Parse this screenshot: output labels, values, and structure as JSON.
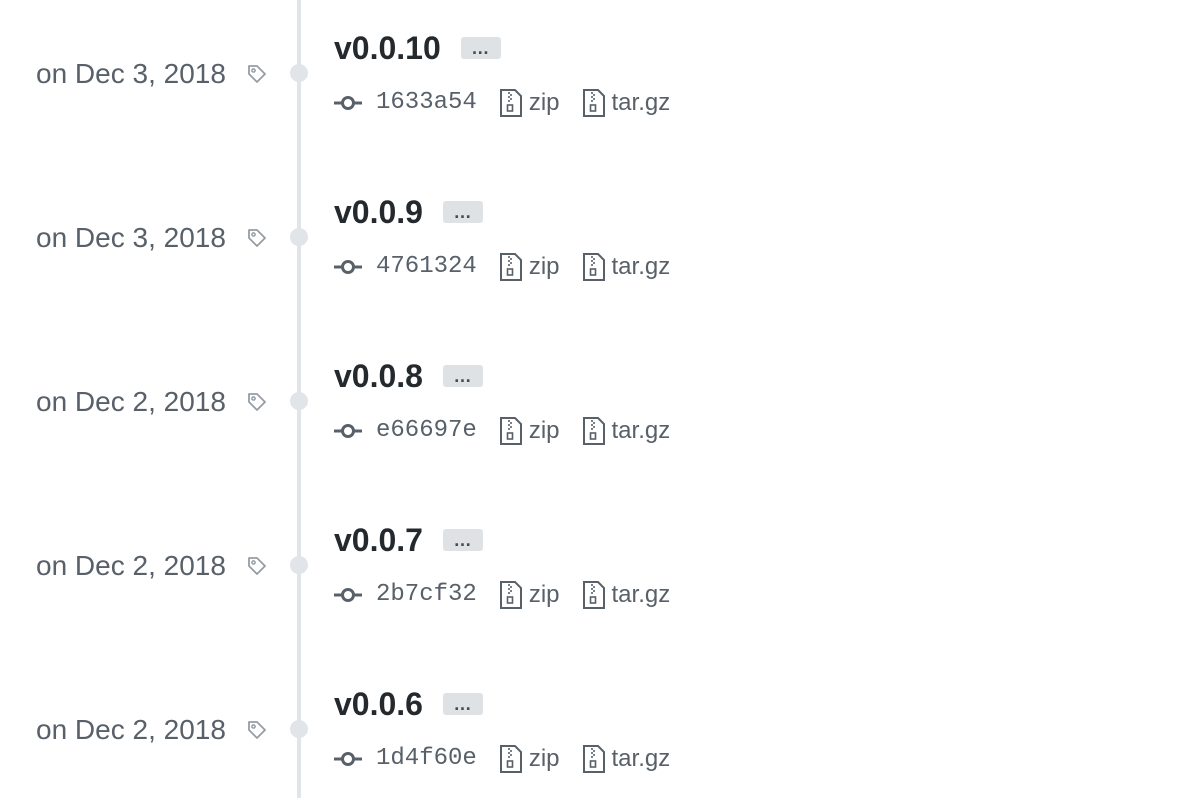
{
  "releases": [
    {
      "date": "on Dec 3, 2018",
      "version": "v0.0.10",
      "more": "…",
      "commit": "1633a54",
      "zip": "zip",
      "targz": "tar.gz"
    },
    {
      "date": "on Dec 3, 2018",
      "version": "v0.0.9",
      "more": "…",
      "commit": "4761324",
      "zip": "zip",
      "targz": "tar.gz"
    },
    {
      "date": "on Dec 2, 2018",
      "version": "v0.0.8",
      "more": "…",
      "commit": "e66697e",
      "zip": "zip",
      "targz": "tar.gz"
    },
    {
      "date": "on Dec 2, 2018",
      "version": "v0.0.7",
      "more": "…",
      "commit": "2b7cf32",
      "zip": "zip",
      "targz": "tar.gz"
    },
    {
      "date": "on Dec 2, 2018",
      "version": "v0.0.6",
      "more": "…",
      "commit": "1d4f60e",
      "zip": "zip",
      "targz": "tar.gz"
    }
  ],
  "icons": {
    "tag": "tag-icon",
    "commit": "git-commit-icon",
    "archive": "file-zip-icon"
  },
  "colors": {
    "text_primary": "#24292e",
    "text_secondary": "#586069",
    "timeline": "#e1e4e8",
    "button_bg": "#dfe2e5"
  }
}
